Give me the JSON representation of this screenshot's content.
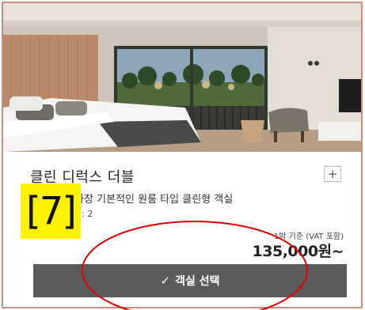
{
  "room": {
    "name": "클린 디럭스 더블",
    "expand_label": "+",
    "description": "에 적합한 가장 기본적인 원룸 타입 클린형 객실",
    "capacity": "2 / 최대 인원 : 2",
    "price_note": "1박 기준 (VAT 포함)",
    "price": "135,000원~"
  },
  "select_button": {
    "icon": "check-icon",
    "check_glyph": "✓",
    "label": "객실 선택"
  },
  "annotation": {
    "tag_label": "[7]",
    "tag_color": "#fff200",
    "circle_color": "#e00000"
  },
  "colors": {
    "button_bg": "#5b5b5b",
    "card_border": "#c98b7c"
  }
}
